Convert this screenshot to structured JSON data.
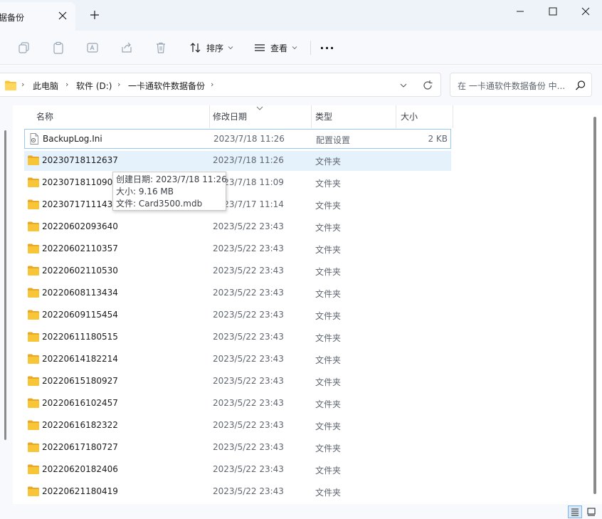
{
  "tab": {
    "title": "数据备份",
    "close_icon": "close-icon",
    "new_tab_icon": "plus-icon"
  },
  "window_controls": {
    "minimize": "minimize-icon",
    "maximize": "maximize-icon",
    "close": "close-icon"
  },
  "toolbar": {
    "icons": [
      "copy-icon",
      "paste-icon",
      "rename-icon",
      "share-icon",
      "delete-icon"
    ],
    "sort_label": "排序",
    "view_label": "查看",
    "more_label": "···"
  },
  "address": {
    "crumbs": [
      "此电脑",
      "软件 (D:)",
      "一卡通软件数据备份"
    ],
    "search_placeholder": "在 一卡通软件数据备份 中..."
  },
  "columns": {
    "name": "名称",
    "date": "修改日期",
    "type": "类型",
    "size": "大小"
  },
  "files": [
    {
      "name": "BackupLog.Ini",
      "date": "2023/7/18 11:26",
      "type": "配置设置",
      "size": "2 KB",
      "kind": "file"
    },
    {
      "name": "20230718112637",
      "date": "2023/7/18 11:26",
      "type": "文件夹",
      "size": "",
      "kind": "folder"
    },
    {
      "name": "20230718110909",
      "date": "2023/7/18 11:09",
      "type": "文件夹",
      "size": "",
      "kind": "folder"
    },
    {
      "name": "20230717111439",
      "date": "2023/7/17 11:14",
      "type": "文件夹",
      "size": "",
      "kind": "folder"
    },
    {
      "name": "20220602093640",
      "date": "2023/5/22 23:43",
      "type": "文件夹",
      "size": "",
      "kind": "folder"
    },
    {
      "name": "20220602110357",
      "date": "2023/5/22 23:43",
      "type": "文件夹",
      "size": "",
      "kind": "folder"
    },
    {
      "name": "20220602110530",
      "date": "2023/5/22 23:43",
      "type": "文件夹",
      "size": "",
      "kind": "folder"
    },
    {
      "name": "20220608113434",
      "date": "2023/5/22 23:43",
      "type": "文件夹",
      "size": "",
      "kind": "folder"
    },
    {
      "name": "20220609115454",
      "date": "2023/5/22 23:43",
      "type": "文件夹",
      "size": "",
      "kind": "folder"
    },
    {
      "name": "20220611180515",
      "date": "2023/5/22 23:43",
      "type": "文件夹",
      "size": "",
      "kind": "folder"
    },
    {
      "name": "20220614182214",
      "date": "2023/5/22 23:43",
      "type": "文件夹",
      "size": "",
      "kind": "folder"
    },
    {
      "name": "20220615180927",
      "date": "2023/5/22 23:43",
      "type": "文件夹",
      "size": "",
      "kind": "folder"
    },
    {
      "name": "20220616102457",
      "date": "2023/5/22 23:43",
      "type": "文件夹",
      "size": "",
      "kind": "folder"
    },
    {
      "name": "20220616182322",
      "date": "2023/5/22 23:43",
      "type": "文件夹",
      "size": "",
      "kind": "folder"
    },
    {
      "name": "20220617180727",
      "date": "2023/5/22 23:43",
      "type": "文件夹",
      "size": "",
      "kind": "folder"
    },
    {
      "name": "20220620182406",
      "date": "2023/5/22 23:43",
      "type": "文件夹",
      "size": "",
      "kind": "folder"
    },
    {
      "name": "20220621180419",
      "date": "2023/5/22 23:43",
      "type": "文件夹",
      "size": "",
      "kind": "folder"
    }
  ],
  "tooltip": {
    "created": "创建日期: 2023/7/18 11:26",
    "size": "大小: 9.16 MB",
    "files": "文件: Card3500.mdb"
  },
  "colors": {
    "folder": "#f8c537",
    "folder_dark": "#e9a825",
    "hover": "#e5f1fb",
    "outline": "#99c9ef",
    "accent": "#0067c0"
  }
}
